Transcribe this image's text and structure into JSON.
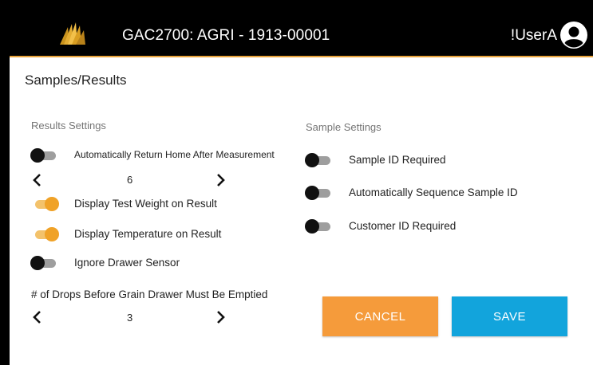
{
  "header": {
    "title": "GAC2700: AGRI - 1913-00001",
    "username": "!UserA",
    "accent_color": "#e8a23a"
  },
  "page": {
    "title": "Samples/Results"
  },
  "results_settings": {
    "heading": "Results Settings",
    "auto_return_home": {
      "label": "Automatically Return Home After Measurement",
      "on": false
    },
    "auto_return_stepper": {
      "value": "6"
    },
    "display_test_weight": {
      "label": "Display Test Weight on Result",
      "on": true
    },
    "display_temperature": {
      "label": "Display Temperature on Result",
      "on": true
    },
    "ignore_drawer_sensor": {
      "label": "Ignore Drawer Sensor",
      "on": false
    },
    "drops_label": "# of Drops Before Grain Drawer Must Be Emptied",
    "drops_stepper": {
      "value": "3"
    }
  },
  "sample_settings": {
    "heading": "Sample Settings",
    "sample_id_required": {
      "label": "Sample ID Required",
      "on": false
    },
    "auto_sequence_sample_id": {
      "label": "Automatically Sequence Sample ID",
      "on": false
    },
    "customer_id_required": {
      "label": "Customer ID Required",
      "on": false
    }
  },
  "actions": {
    "cancel_label": "CANCEL",
    "save_label": "SAVE",
    "cancel_color": "#f59b3b",
    "save_color": "#12a4dc"
  },
  "icons": [
    "app-logo-icon",
    "user-account-icon",
    "chevron-left-icon",
    "chevron-right-icon"
  ]
}
